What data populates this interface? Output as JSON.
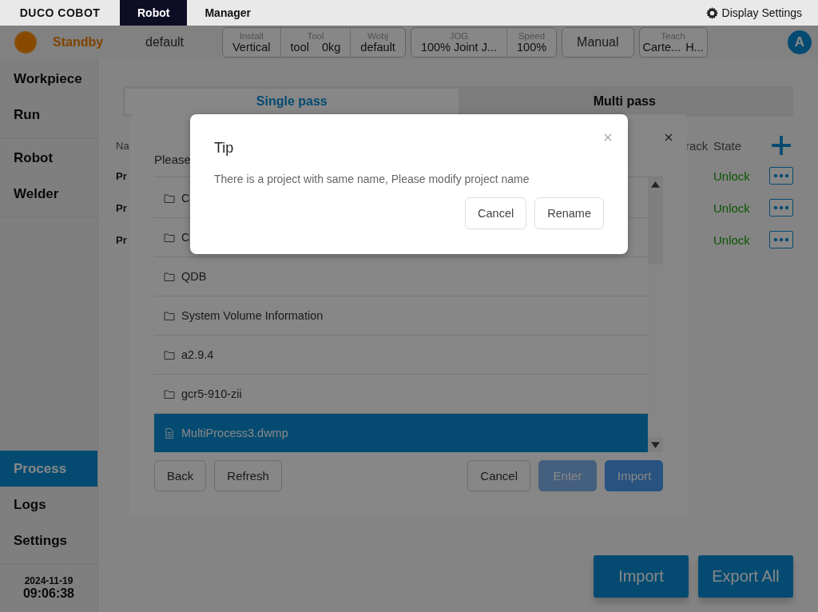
{
  "header": {
    "logo": "DUCO COBOT",
    "tabs": [
      {
        "label": "Robot",
        "selected": true
      },
      {
        "label": "Manager",
        "selected": false
      }
    ],
    "display_settings": "Display Settings"
  },
  "status": {
    "state": "Standby",
    "project": "default",
    "groups": [
      {
        "fields": [
          {
            "label": "Install",
            "values": [
              "Vertical"
            ]
          },
          {
            "label": "Tool",
            "values": [
              "tool",
              "0kg"
            ]
          },
          {
            "label": "Wobj",
            "values": [
              "default"
            ]
          }
        ]
      },
      {
        "fields": [
          {
            "label": "JOG",
            "values": [
              "100% Joint J..."
            ]
          },
          {
            "label": "Speed",
            "values": [
              "100%"
            ]
          }
        ]
      }
    ],
    "mode": "Manual",
    "teach": {
      "label": "Teach",
      "values": [
        "Carte...",
        "H..."
      ]
    },
    "avatar": "A"
  },
  "sidebar": {
    "top": [
      {
        "label": "Workpiece",
        "selected": false
      },
      {
        "label": "Run",
        "selected": false
      }
    ],
    "middle": [
      {
        "label": "Robot",
        "selected": false
      },
      {
        "label": "Welder",
        "selected": false
      }
    ],
    "bottom": [
      {
        "label": "Process",
        "selected": true
      },
      {
        "label": "Logs",
        "selected": false
      },
      {
        "label": "Settings",
        "selected": false
      }
    ],
    "date": "2024-11-19",
    "time": "09:06:38"
  },
  "content_tabs": [
    {
      "label": "Single pass",
      "selected": true
    },
    {
      "label": "Multi pass",
      "selected": false
    }
  ],
  "table": {
    "columns": [
      "Na",
      "rack",
      "State"
    ],
    "rows": [
      {
        "name": "Pr",
        "state": "Unlock"
      },
      {
        "name": "Pr",
        "state": "Unlock"
      },
      {
        "name": "Pr",
        "state": "Unlock"
      }
    ]
  },
  "file_dialog": {
    "prompt": "Please",
    "files": [
      {
        "name": "C",
        "kind": "folder",
        "selected": false
      },
      {
        "name": "C",
        "kind": "folder",
        "selected": false
      },
      {
        "name": "QDB",
        "kind": "folder",
        "selected": false
      },
      {
        "name": "System Volume Information",
        "kind": "folder",
        "selected": false
      },
      {
        "name": "a2.9.4",
        "kind": "folder",
        "selected": false
      },
      {
        "name": "gcr5-910-zii",
        "kind": "folder",
        "selected": false
      },
      {
        "name": "MultiProcess3.dwmp",
        "kind": "file",
        "selected": true
      }
    ],
    "left_buttons": [
      {
        "label": "Back",
        "kind": "plain",
        "disabled": false
      },
      {
        "label": "Refresh",
        "kind": "plain",
        "disabled": false
      }
    ],
    "right_buttons": [
      {
        "label": "Cancel",
        "kind": "plain",
        "disabled": false
      },
      {
        "label": "Enter",
        "kind": "primary",
        "disabled": true
      },
      {
        "label": "Import",
        "kind": "primary",
        "disabled": false
      }
    ]
  },
  "tip": {
    "title": "Tip",
    "message": "There is a project with same name, Please modify project name",
    "buttons": [
      "Cancel",
      "Rename"
    ]
  },
  "bottom_buttons": [
    "Import",
    "Export All"
  ]
}
